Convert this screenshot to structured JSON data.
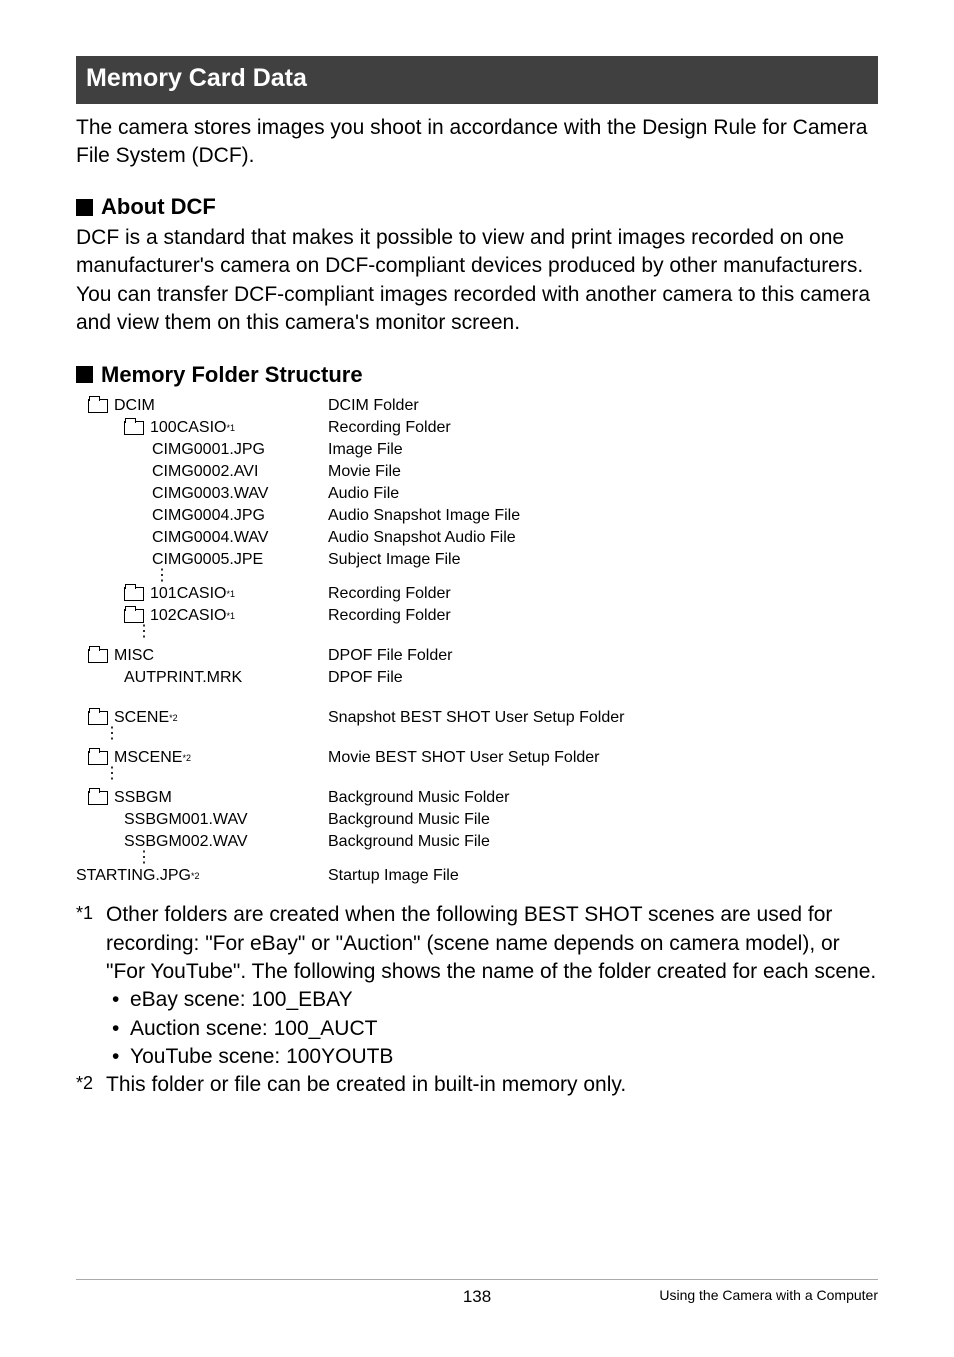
{
  "section_title": "Memory Card Data",
  "intro": "The camera stores images you shoot in accordance with the Design Rule for Camera File System (DCF).",
  "subhead1": "About DCF",
  "about_dcf": "DCF is a standard that makes it possible to view and print images recorded on one manufacturer's camera on DCF-compliant devices produced by other manufacturers. You can transfer DCF-compliant images recorded with another camera to this camera and view them on this camera's monitor screen.",
  "subhead2": "Memory Folder Structure",
  "tree": {
    "dcim_name": "DCIM",
    "dcim_desc": "DCIM Folder",
    "f100_name": "100CASIO",
    "f100_sup": "*1",
    "f100_desc": "Recording Folder",
    "r0001_name": "CIMG0001.JPG",
    "r0001_desc": "Image File",
    "r0002_name": "CIMG0002.AVI",
    "r0002_desc": "Movie File",
    "r0003_name": "CIMG0003.WAV",
    "r0003_desc": "Audio File",
    "r0004_name": "CIMG0004.JPG",
    "r0004_desc": "Audio Snapshot Image File",
    "r0004w_name": "CIMG0004.WAV",
    "r0004w_desc": "Audio Snapshot Audio File",
    "r0005_name": "CIMG0005.JPE",
    "r0005_desc": "Subject Image File",
    "f101_name": "101CASIO",
    "f101_sup": "*1",
    "f101_desc": "Recording Folder",
    "f102_name": "102CASIO",
    "f102_sup": "*1",
    "f102_desc": "Recording Folder",
    "misc_name": "MISC",
    "misc_desc": "DPOF File Folder",
    "autp_name": "AUTPRINT.MRK",
    "autp_desc": "DPOF File",
    "scene_name": "SCENE",
    "scene_sup": "*2",
    "scene_desc": "Snapshot BEST SHOT User Setup Folder",
    "mscene_name": "MSCENE",
    "mscene_sup": "*2",
    "mscene_desc": "Movie BEST SHOT User Setup Folder",
    "ssbgm_name": "SSBGM",
    "ssbgm_desc": "Background Music Folder",
    "ss1_name": "SSBGM001.WAV",
    "ss1_desc": "Background Music File",
    "ss2_name": "SSBGM002.WAV",
    "ss2_desc": "Background Music File",
    "start_name": "STARTING.JPG",
    "start_sup": "*2",
    "start_desc": "Startup Image File"
  },
  "note1_marker": "*1",
  "note1_text": "Other folders are created when the following BEST SHOT scenes are used for recording: \"For eBay\" or \"Auction\" (scene name depends on camera model), or \"For YouTube\". The following shows the name of the folder created for each scene.",
  "bullet1": "eBay scene: 100_EBAY",
  "bullet2": "Auction scene: 100_AUCT",
  "bullet3": "YouTube scene: 100YOUTB",
  "note2_marker": "*2",
  "note2_text": "This folder or file can be created in built-in memory only.",
  "footer_page": "138",
  "footer_chapter": "Using the Camera with a Computer"
}
